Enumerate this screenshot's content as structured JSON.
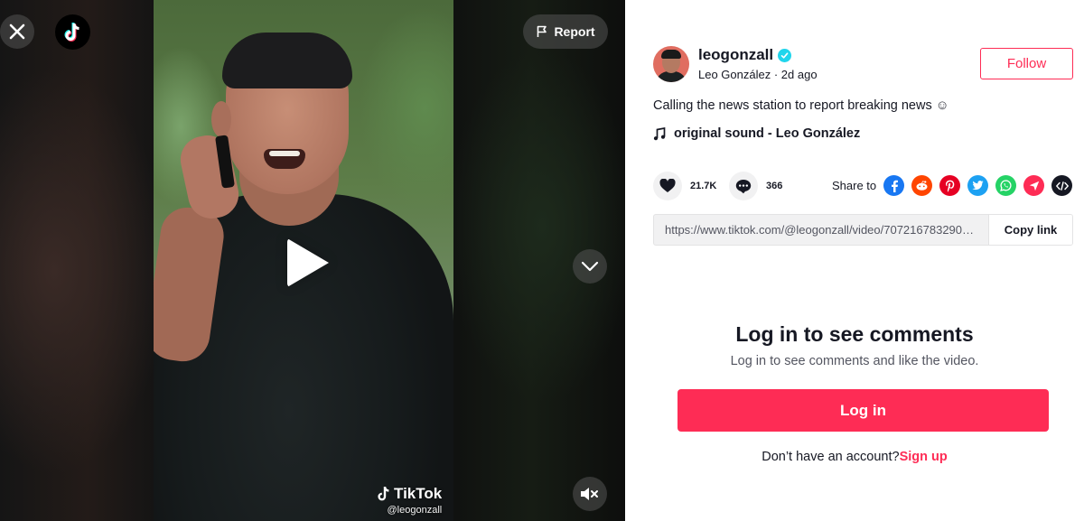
{
  "video": {
    "report_label": "Report",
    "watermark_brand": "TikTok",
    "watermark_user": "@leogonzall"
  },
  "author": {
    "username": "leogonzall",
    "display_name": "Leo González",
    "posted": "2d ago",
    "separator": " · ",
    "follow_label": "Follow",
    "verified": true
  },
  "post": {
    "description": "Calling the news station to report breaking news ☺",
    "music": "original sound - Leo González"
  },
  "stats": {
    "likes": "21.7K",
    "comments": "366"
  },
  "share": {
    "label": "Share to",
    "targets": [
      {
        "name": "facebook",
        "color": "#1877f2"
      },
      {
        "name": "reddit",
        "color": "#ff4500"
      },
      {
        "name": "pinterest",
        "color": "#e60023"
      },
      {
        "name": "twitter",
        "color": "#1da1f2"
      },
      {
        "name": "whatsapp",
        "color": "#25d366"
      },
      {
        "name": "telegram-send",
        "color": "#fe2c55"
      },
      {
        "name": "embed",
        "color": "#161823"
      }
    ]
  },
  "link": {
    "url": "https://www.tiktok.com/@leogonzall/video/7072167832909...",
    "copy_label": "Copy link"
  },
  "login": {
    "title": "Log in to see comments",
    "subtitle": "Log in to see comments and like the video.",
    "button_label": "Log in",
    "no_account": "Don’t have an account?",
    "signup_label": "Sign up"
  },
  "colors": {
    "accent": "#fe2c55",
    "verified": "#20d5ec"
  }
}
